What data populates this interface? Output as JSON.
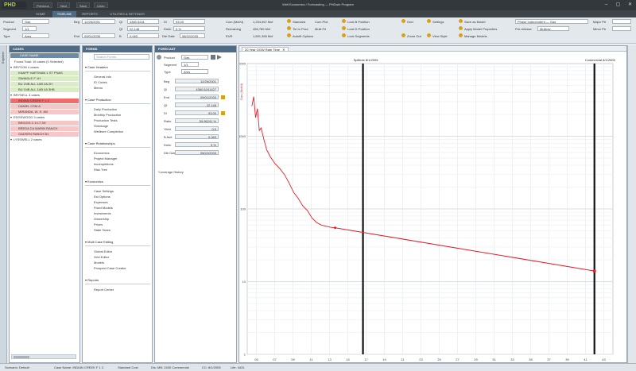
{
  "app": {
    "logo": "PHD",
    "quick_access": [
      "Previous",
      "Next",
      "Save",
      "Undo"
    ],
    "title": "Well Economics / Forecasting — PHDwin Program",
    "tabs": [
      "HOME",
      "TIMELINE",
      "REPORTS",
      "UTILITIES & SETTINGS"
    ],
    "window_buttons": [
      "–",
      "▢",
      "✕"
    ]
  },
  "ribbon": {
    "product_label": "Product",
    "product_value": "Gas",
    "segment_label": "Segment",
    "segment_value": "1/1",
    "type_label": "Type",
    "type_value": "Arps",
    "begin_label": "Beg",
    "begin_value": "12/26/2001",
    "end_label": "End",
    "end_value": "09/01/2033",
    "qi_label": "Qi",
    "qi_value": "4360.5241",
    "qf_label": "Qf",
    "qf_value": "22.148",
    "b_label": "B",
    "b_value": "0.063",
    "di_label": "Di",
    "di_value": "93.00",
    "dmin_label": "Dmin",
    "dmin_value": "5 %",
    "date_label": "Dte Date",
    "date_value": "08/22/2033",
    "cum_label": "Cum (Mcf/d)",
    "cum_value": "1,234,567 Mcf",
    "rem_label": "Remaining",
    "rem_value": "456,789 Mcf",
    "eur_label": "EUR",
    "eur_value": "1,691,356 Mcf",
    "col3": [
      "Standard",
      "Tie to Prod",
      "Autofit Options"
    ],
    "col3b": [
      "Cum Plot",
      "Multi Fit",
      "Filter"
    ],
    "col4": [
      "Lock B Position",
      "Lock D Position",
      "Lock Segments"
    ],
    "col5": [
      "Grid",
      "Zoom Out"
    ],
    "col5b": [
      "Settings",
      "Save as Model",
      "View Style"
    ],
    "col6": [
      "Settings",
      "Apply Model Properties",
      "Manage Models"
    ],
    "independent_label": "Phase Independent — Gas",
    "pre_release_label": "Pre-release",
    "pre_release_value": "Multiply",
    "major_label": "Major Ptr",
    "minor_label": "Minor Ptr"
  },
  "sidetab": "Explorer",
  "cases": {
    "header": "CASES",
    "subheader": "CASE NAME",
    "summary": "Found Total: 15 cases (0 Selected)",
    "rows": [
      {
        "text": "BRYSON  4 cases",
        "bg": "#ffffff",
        "indent": 0
      },
      {
        "text": "KNAPP HARTMAN 1 ST PNAS",
        "bg": "#d9ecc6",
        "indent": 1
      },
      {
        "text": "SWINDLE F 1H",
        "bg": "#d9ecc6",
        "indent": 1
      },
      {
        "text": "BU 1NB ALL 1AB 4A 2H",
        "bg": "#d9ecc6",
        "indent": 1
      },
      {
        "text": "BU 1NB ALL 1AB 4A 3HB",
        "bg": "#d9ecc6",
        "indent": 1
      },
      {
        "text": "BRYNELL  4 cases",
        "bg": "#ffffff",
        "indent": 0
      },
      {
        "text": "INDIAN CREEK F 1 C",
        "bg": "#f26b6b",
        "indent": 1
      },
      {
        "text": "DANIEL CSM A",
        "bg": "#f7c7c7",
        "indent": 1
      },
      {
        "text": "MIRANDA, W. S. 4M",
        "bg": "#f7c7c7",
        "indent": 1
      },
      {
        "text": "EDGEWOOD  3 cases",
        "bg": "#ffffff",
        "indent": 0
      },
      {
        "text": "BRIGGS C 6 LT 3H",
        "bg": "#f7c7c7",
        "indent": 1
      },
      {
        "text": "BREDA CA MARIN RANCH",
        "bg": "#f7c7c7",
        "indent": 1
      },
      {
        "text": "GADSEN RANCH B1",
        "bg": "#f7c7c7",
        "indent": 1
      },
      {
        "text": "LYSSWELL  2 cases",
        "bg": "#ffffff",
        "indent": 0
      }
    ]
  },
  "forms": {
    "header": "FORMS",
    "search_placeholder": "Search Forms",
    "sections": [
      {
        "title": "Case Headers",
        "items": [
          "General Info",
          "ID Codes",
          "Memo"
        ]
      },
      {
        "title": "Case Production",
        "items": [
          "Daily Production",
          "Monthly Production",
          "Production Tests",
          "Shrinkage",
          "Wellbore Completion"
        ]
      },
      {
        "title": "Case Relationships",
        "items": [
          "Economics",
          "Project Manager",
          "Incompletions",
          "Risk Tree"
        ]
      },
      {
        "title": "Economics",
        "items": [
          "Case Settings",
          "Est Options",
          "Expenses",
          "Fixed Models",
          "Investments",
          "Ownership",
          "Prices",
          "State Taxes"
        ]
      },
      {
        "title": "Multi Case Editing",
        "items": [
          "Global Editor",
          "Grid Editor",
          "Models",
          "Prospect Case Creator"
        ]
      },
      {
        "title": "Reports",
        "items": [
          "Report Center"
        ]
      }
    ]
  },
  "forecast": {
    "header": "FORECAST",
    "product_label": "Product",
    "product_value": "Gas",
    "segment_label": "Segment",
    "segment_value": "1/1",
    "type_label": "Type",
    "type_value": "Arps",
    "rows": [
      {
        "label": "Beg",
        "value": "12/26/2001"
      },
      {
        "label": "Qi",
        "value": "4360.5241427"
      },
      {
        "label": "End",
        "value": "09/01/2033"
      },
      {
        "label": "Qf",
        "value": "22.148"
      },
      {
        "label": "Di",
        "value": "93.00"
      },
      {
        "label": "Ratio",
        "value": "59.96241 %"
      },
      {
        "label": "Yield",
        "value": "0.0"
      },
      {
        "label": "B-fact",
        "value": "0.063"
      },
      {
        "label": "Dmin",
        "value": "5 %"
      },
      {
        "label": "Dte Date",
        "value": "08/22/2033"
      }
    ],
    "footer": "*Leverage History"
  },
  "chart": {
    "tab_label": "20 Year OGW Rate Time",
    "ylabel": "Gas (Mcf/d)",
    "marker_left": "Spilltute  8/1/2005",
    "marker_right": "Commercial  8/1/2005",
    "x_ticks": [
      "05",
      "07",
      "09",
      "11",
      "13",
      "15",
      "17",
      "19",
      "21",
      "23",
      "25",
      "27",
      "29",
      "31",
      "33",
      "35",
      "37",
      "39",
      "41",
      "43"
    ],
    "y_ticks": [
      "10000",
      "1000",
      "100",
      "10",
      "1"
    ]
  },
  "chart_data": {
    "type": "line",
    "title": "20 Year OGW Rate Time",
    "xlabel": "",
    "ylabel": "Gas (Mcf/d)",
    "series": [
      {
        "name": "History",
        "color": "#e0202a",
        "x": [
          2005.0,
          2005.2,
          2005.4,
          2005.6,
          2005.8,
          2006.0,
          2006.3,
          2006.6,
          2007.0,
          2007.5,
          2008.0,
          2008.5,
          2009.0,
          2009.5,
          2010.0,
          2010.5,
          2011.0,
          2011.5,
          2012.0,
          2012.5,
          2013.0,
          2013.5,
          2014.0
        ],
        "y": [
          2600,
          3500,
          1800,
          2400,
          1200,
          1300,
          900,
          650,
          520,
          420,
          360,
          300,
          230,
          170,
          140,
          110,
          95,
          75,
          65,
          60,
          58,
          56,
          55
        ]
      },
      {
        "name": "Forecast",
        "color": "#e0202a",
        "x": [
          2014.0,
          2042.0
        ],
        "y": [
          55,
          14
        ]
      }
    ],
    "markers": [
      {
        "label": "Spilltute  8/1/2005",
        "x": 2017.0
      },
      {
        "label": "Commercial  8/1/2005",
        "x": 2042.0
      }
    ],
    "ylim": [
      1,
      10000
    ],
    "log_y": true,
    "xlim": [
      2004.5,
      2044.0
    ]
  },
  "status": {
    "scenario": "Scenario: Default",
    "case": "Case Name: INDIAN CREEK F 1 C",
    "cost": "Standard Cost",
    "dates": "Dis: MB: 2430  Commercial",
    "cc": "CC: 8/1/2005",
    "life": "Life: 4431"
  }
}
